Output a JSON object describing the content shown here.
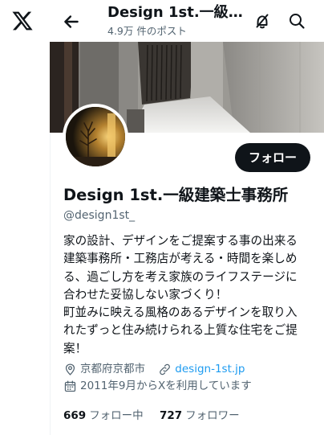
{
  "header": {
    "title": "Design 1st.一級建築士事務所",
    "subtitle": "4.9万 件のポスト"
  },
  "icons": {
    "logo": "x-logo",
    "back": "arrow-left-icon",
    "notifications_off": "bell-slash-icon",
    "search": "search-icon",
    "location": "location-pin-icon",
    "link": "link-icon",
    "calendar": "calendar-icon"
  },
  "profile": {
    "name": "Design 1st.一級建築士事務所",
    "handle": "@design1st_",
    "follow_label": "フォロー",
    "bio_lines": [
      "家の設計、デザインをご提案する事の出来る",
      "建築事務所・工務店が考える・時間を楽しめ",
      "る、過ごし方を考え家族のライフステージに",
      "合わせた妥協しない家づくり！",
      "町並みに映える風格のあるデザインを取り入",
      "れたずっと住み続けられる上質な住宅をご提",
      "案！"
    ],
    "location": "京都府京都市",
    "website": "design-1st.jp",
    "joined": "2011年9月からXを利用しています",
    "following_count": "669",
    "following_label": "フォロー中",
    "followers_count": "727",
    "followers_label": "フォロワー"
  },
  "colors": {
    "text": "#0f1419",
    "secondary": "#536471",
    "link": "#1d9bf0",
    "button_bg": "#0f1419",
    "button_text": "#ffffff"
  }
}
